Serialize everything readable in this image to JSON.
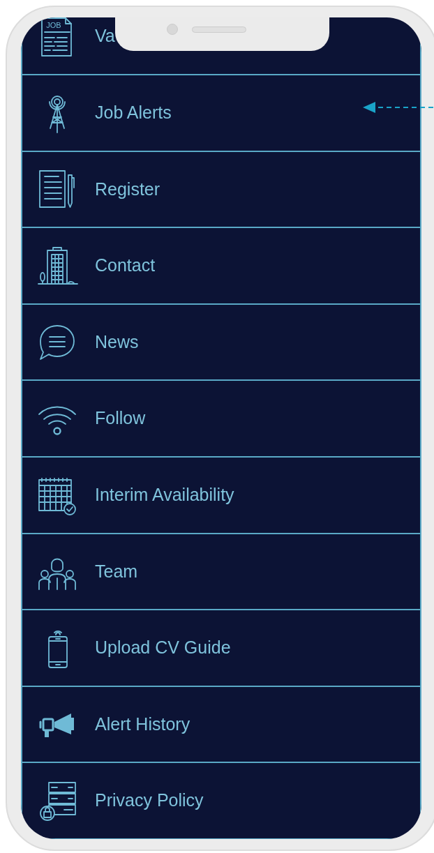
{
  "menu": {
    "items": [
      {
        "label": "Va",
        "icon_label": "JOB",
        "marked": false
      },
      {
        "label": "Job Alerts",
        "marked": true
      },
      {
        "label": "Register",
        "marked": false
      },
      {
        "label": "Contact",
        "marked": false
      },
      {
        "label": "News",
        "marked": false
      },
      {
        "label": "Follow",
        "marked": false
      },
      {
        "label": "Interim Availability",
        "marked": false
      },
      {
        "label": "Team",
        "marked": false
      },
      {
        "label": "Upload CV Guide",
        "marked": false
      },
      {
        "label": "Alert History",
        "marked": false
      },
      {
        "label": "Privacy Policy",
        "marked": false
      }
    ]
  }
}
